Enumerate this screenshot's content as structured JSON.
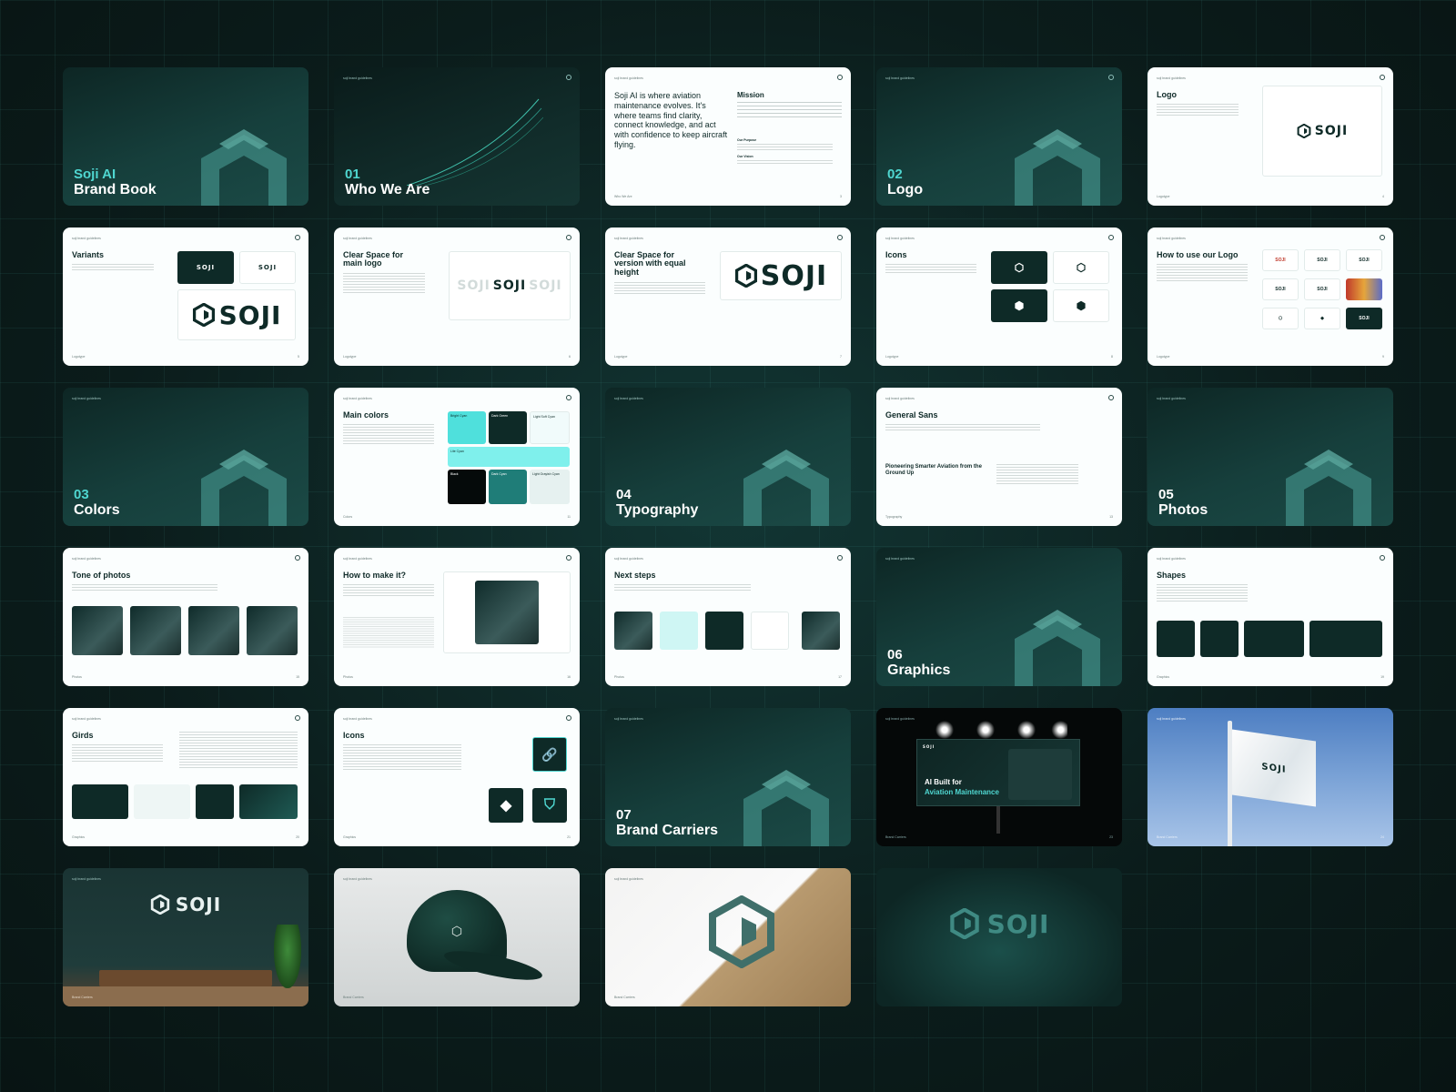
{
  "header_text": "soji brand guidelines",
  "cover": {
    "line1": "Soji AI",
    "line2": "Brand Book"
  },
  "sections": [
    {
      "num": "01",
      "title": "Who We Are"
    },
    {
      "num": "02",
      "title": "Logo"
    },
    {
      "num": "03",
      "title": "Colors"
    },
    {
      "num": "04",
      "title": "Typography"
    },
    {
      "num": "05",
      "title": "Photos"
    },
    {
      "num": "06",
      "title": "Graphics"
    },
    {
      "num": "07",
      "title": "Brand Carriers"
    }
  ],
  "mission": {
    "statement": "Soji AI is where aviation maintenance evolves. It's where teams find clarity, connect knowledge, and act with confidence to keep aircraft flying.",
    "heading": "Mission",
    "sub1": "Our Purpose",
    "sub2": "Our Vision",
    "footer": "Who We Are",
    "page": "3"
  },
  "slides": {
    "logo": {
      "title": "Logo",
      "word": "SOJI",
      "footer": "Logotype",
      "page": "4"
    },
    "variants": {
      "title": "Variants",
      "word": "SOJI",
      "footer": "Logotype",
      "page": "5"
    },
    "clearspace": {
      "title": "Clear Space for main logo",
      "word": "SOJI",
      "footer": "Logotype",
      "page": "6"
    },
    "clearspace2": {
      "title": "Clear Space for version with equal height",
      "word": "SOJI",
      "footer": "Logotype",
      "page": "7"
    },
    "icons": {
      "title": "Icons",
      "footer": "Logotype",
      "page": "8"
    },
    "howto": {
      "title": "How to use our Logo",
      "footer": "Logotype",
      "page": "9"
    },
    "maincolors": {
      "title": "Main colors",
      "footer": "Colors",
      "page": "11",
      "swatches": [
        "Bright Cyan",
        "Dark Green",
        "Light Soft Cyan",
        "Lite Cyan",
        "Black",
        "Dark Cyan",
        "Light Grayish Cyan"
      ]
    },
    "generalsans": {
      "title": "General Sans",
      "headline": "Pioneering Smarter Aviation from the Ground Up",
      "footer": "Typography",
      "page": "13"
    },
    "tone": {
      "title": "Tone of photos",
      "footer": "Photos",
      "page": "15"
    },
    "howmake": {
      "title": "How to make it?",
      "footer": "Photos",
      "page": "16"
    },
    "nextsteps": {
      "title": "Next steps",
      "footer": "Photos",
      "page": "17"
    },
    "shapes": {
      "title": "Shapes",
      "footer": "Graphics",
      "page": "19"
    },
    "girds": {
      "title": "Girds",
      "footer": "Graphics",
      "page": "20"
    },
    "icons2": {
      "title": "Icons",
      "footer": "Graphics",
      "page": "21"
    },
    "billboard": {
      "line1": "AI Built for",
      "line2": "Aviation Maintenance",
      "brand": "SOJI",
      "footer": "Brand Carriers",
      "page": "23"
    },
    "flag": {
      "word": "SOJI",
      "footer": "Brand Carriers",
      "page": "24"
    },
    "office": {
      "word": "SOJI",
      "footer": "Brand Carriers"
    },
    "cap": {
      "footer": "Brand Carriers"
    },
    "paper": {
      "footer": "Brand Carriers"
    },
    "final": {
      "word": "SOJI"
    }
  },
  "colors": {
    "bg": "#0c1d1c",
    "accent": "#4fd6d0",
    "dark_green": "#0e2a27"
  }
}
